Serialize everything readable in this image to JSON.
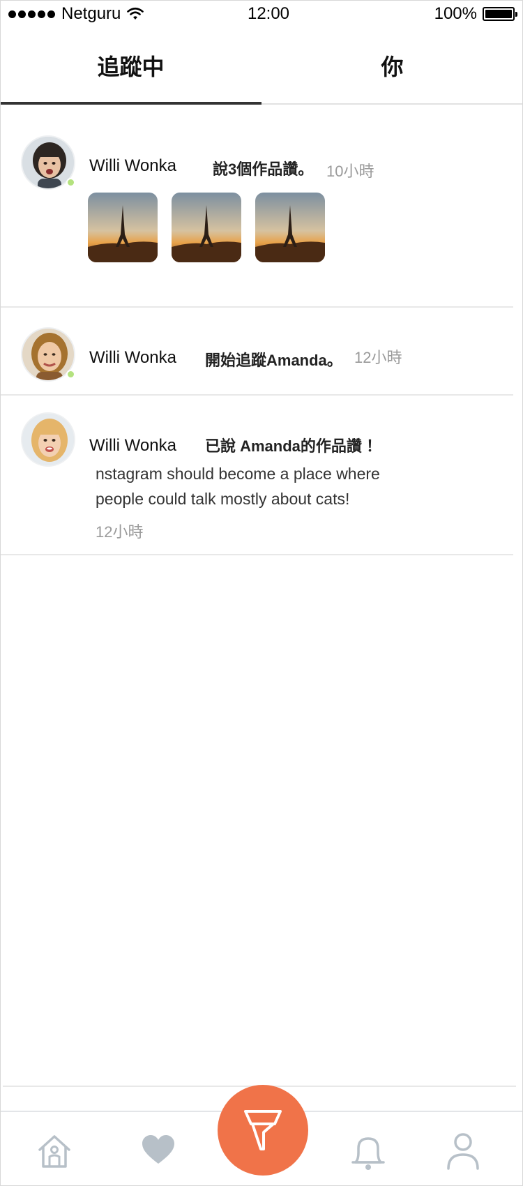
{
  "status_bar": {
    "carrier": "Netguru",
    "time": "12:00",
    "battery": "100%"
  },
  "tabs": [
    {
      "label": "追蹤中",
      "active": true
    },
    {
      "label": "你",
      "active": false
    }
  ],
  "feed": [
    {
      "username": "Willi Wonka",
      "action": "說3個作品讚。",
      "time": "10小時",
      "online": true,
      "thumbnails": [
        "eiffel-tower-sunset",
        "eiffel-tower-sunset",
        "eiffel-tower-sunset"
      ]
    },
    {
      "username": "Willi Wonka",
      "action": "開始追蹤Amanda。",
      "time": "12小時",
      "online": true
    },
    {
      "username": "Willi Wonka",
      "action": "已說 Amanda的作品讚 ！",
      "comment_line1": "nstagram should become a place where",
      "comment_line2": "people could talk mostly about cats!",
      "time": "12小時",
      "online": false
    }
  ],
  "bottom_nav": {
    "items": [
      "home-icon",
      "heart-icon",
      "filter-icon",
      "bell-icon",
      "profile-icon"
    ],
    "accent_color": "#f07349",
    "icon_color": "#b7c0c8"
  }
}
